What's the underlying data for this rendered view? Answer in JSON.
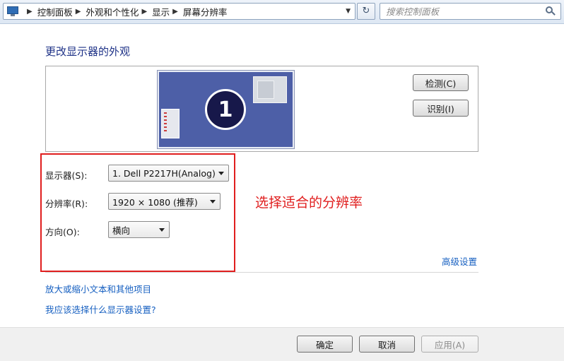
{
  "address_bar": {
    "breadcrumbs": [
      "控制面板",
      "外观和个性化",
      "显示",
      "屏幕分辨率"
    ],
    "search_placeholder": "搜索控制面板"
  },
  "page": {
    "title": "更改显示器的外观"
  },
  "preview": {
    "monitor_number": "1",
    "detect_label": "检测(C)",
    "identify_label": "识别(I)"
  },
  "settings": {
    "display_label": "显示器(S):",
    "display_value": "1. Dell P2217H(Analog)",
    "resolution_label": "分辨率(R):",
    "resolution_value": "1920 × 1080 (推荐)",
    "orientation_label": "方向(O):",
    "orientation_value": "横向"
  },
  "annotation": "选择适合的分辨率",
  "links": {
    "advanced": "高级设置",
    "zoom_text": "放大或缩小文本和其他项目",
    "which_settings": "我应该选择什么显示器设置?"
  },
  "footer": {
    "ok_label": "确定",
    "cancel_label": "取消",
    "apply_label": "应用(A)"
  },
  "colors": {
    "title": "#1e3287",
    "link": "#1760c1",
    "annotation": "#e01e1e",
    "monitor": "#4d5fa7"
  }
}
